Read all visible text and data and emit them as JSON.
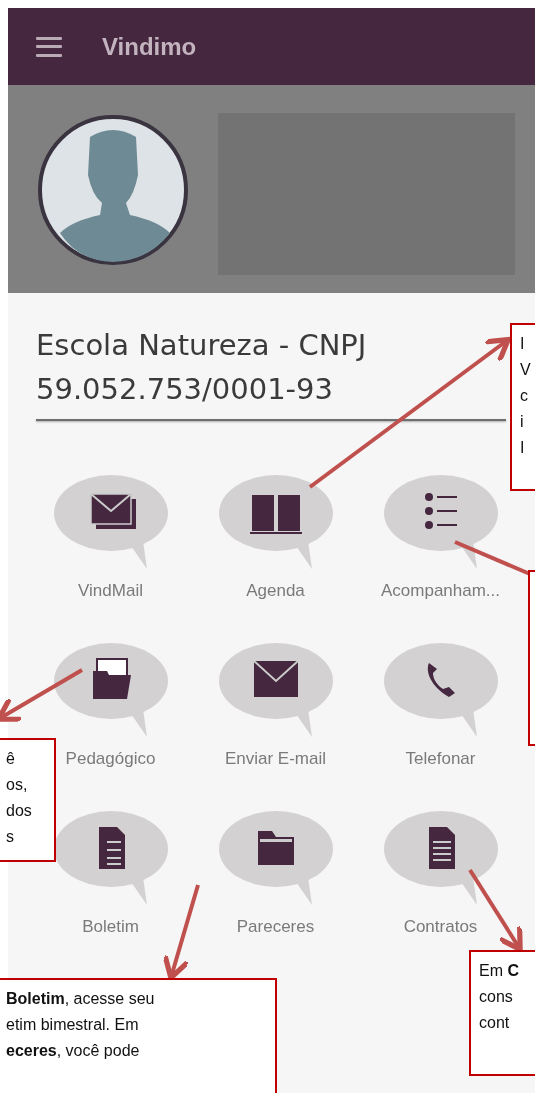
{
  "app_bar": {
    "title": "Vindimo"
  },
  "school": {
    "name": "Escola Natureza - CNPJ",
    "cnpj": "59.052.753/0001-93"
  },
  "menu": [
    {
      "label": "VindMail",
      "kind": "mailstack"
    },
    {
      "label": "Agenda",
      "kind": "book"
    },
    {
      "label": "Acompanham...",
      "kind": "checklist"
    },
    {
      "label": "Pedagógico",
      "kind": "folderdoc"
    },
    {
      "label": "Enviar E-mail",
      "kind": "envelope"
    },
    {
      "label": "Telefonar",
      "kind": "phone"
    },
    {
      "label": "Boletim",
      "kind": "report"
    },
    {
      "label": "Pareceres",
      "kind": "folder"
    },
    {
      "label": "Contratos",
      "kind": "document"
    }
  ],
  "callouts": [
    {
      "lines": [
        "I",
        "V",
        "c",
        "i",
        "I"
      ]
    },
    {
      "lines": [
        "ê",
        "os,",
        "dos",
        "s"
      ]
    },
    {
      "lines": [
        "**Boletim**, acesse seu",
        "etim bimestral. Em",
        "**eceres**, você pode"
      ]
    },
    {
      "lines": [
        "Em **C**",
        "cons",
        "cont"
      ]
    }
  ]
}
